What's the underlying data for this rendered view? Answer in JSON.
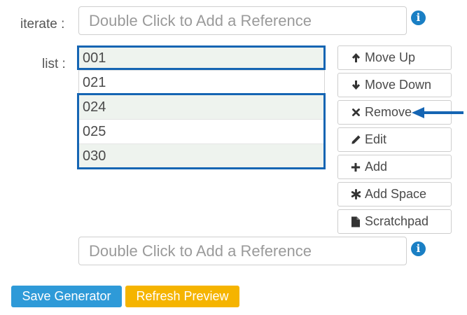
{
  "form": {
    "iterate_label": "iterate :",
    "iterate_placeholder": "Double Click to Add a Reference",
    "list_label": "list :",
    "list_items": [
      "001",
      "021",
      "024",
      "025",
      "030"
    ],
    "bottom_placeholder": "Double Click to Add a Reference"
  },
  "buttons": {
    "move_up": "Move Up",
    "move_down": "Move Down",
    "remove": "Remove",
    "edit": "Edit",
    "add": "Add",
    "add_space": "Add Space",
    "scratchpad": "Scratchpad"
  },
  "actions": {
    "save": "Save Generator",
    "refresh": "Refresh Preview"
  },
  "colors": {
    "save_bg": "#2e9ad8",
    "refresh_bg": "#f5b400",
    "info_icon": "#1a7fc4",
    "highlight": "#1565b3",
    "arrow": "#1565b3"
  },
  "icons": {
    "info": "info-circle-icon",
    "move_up": "arrow-up-icon",
    "move_down": "arrow-down-icon",
    "remove": "times-icon",
    "edit": "pencil-icon",
    "add": "plus-icon",
    "add_space": "asterisk-icon",
    "scratchpad": "file-icon"
  }
}
